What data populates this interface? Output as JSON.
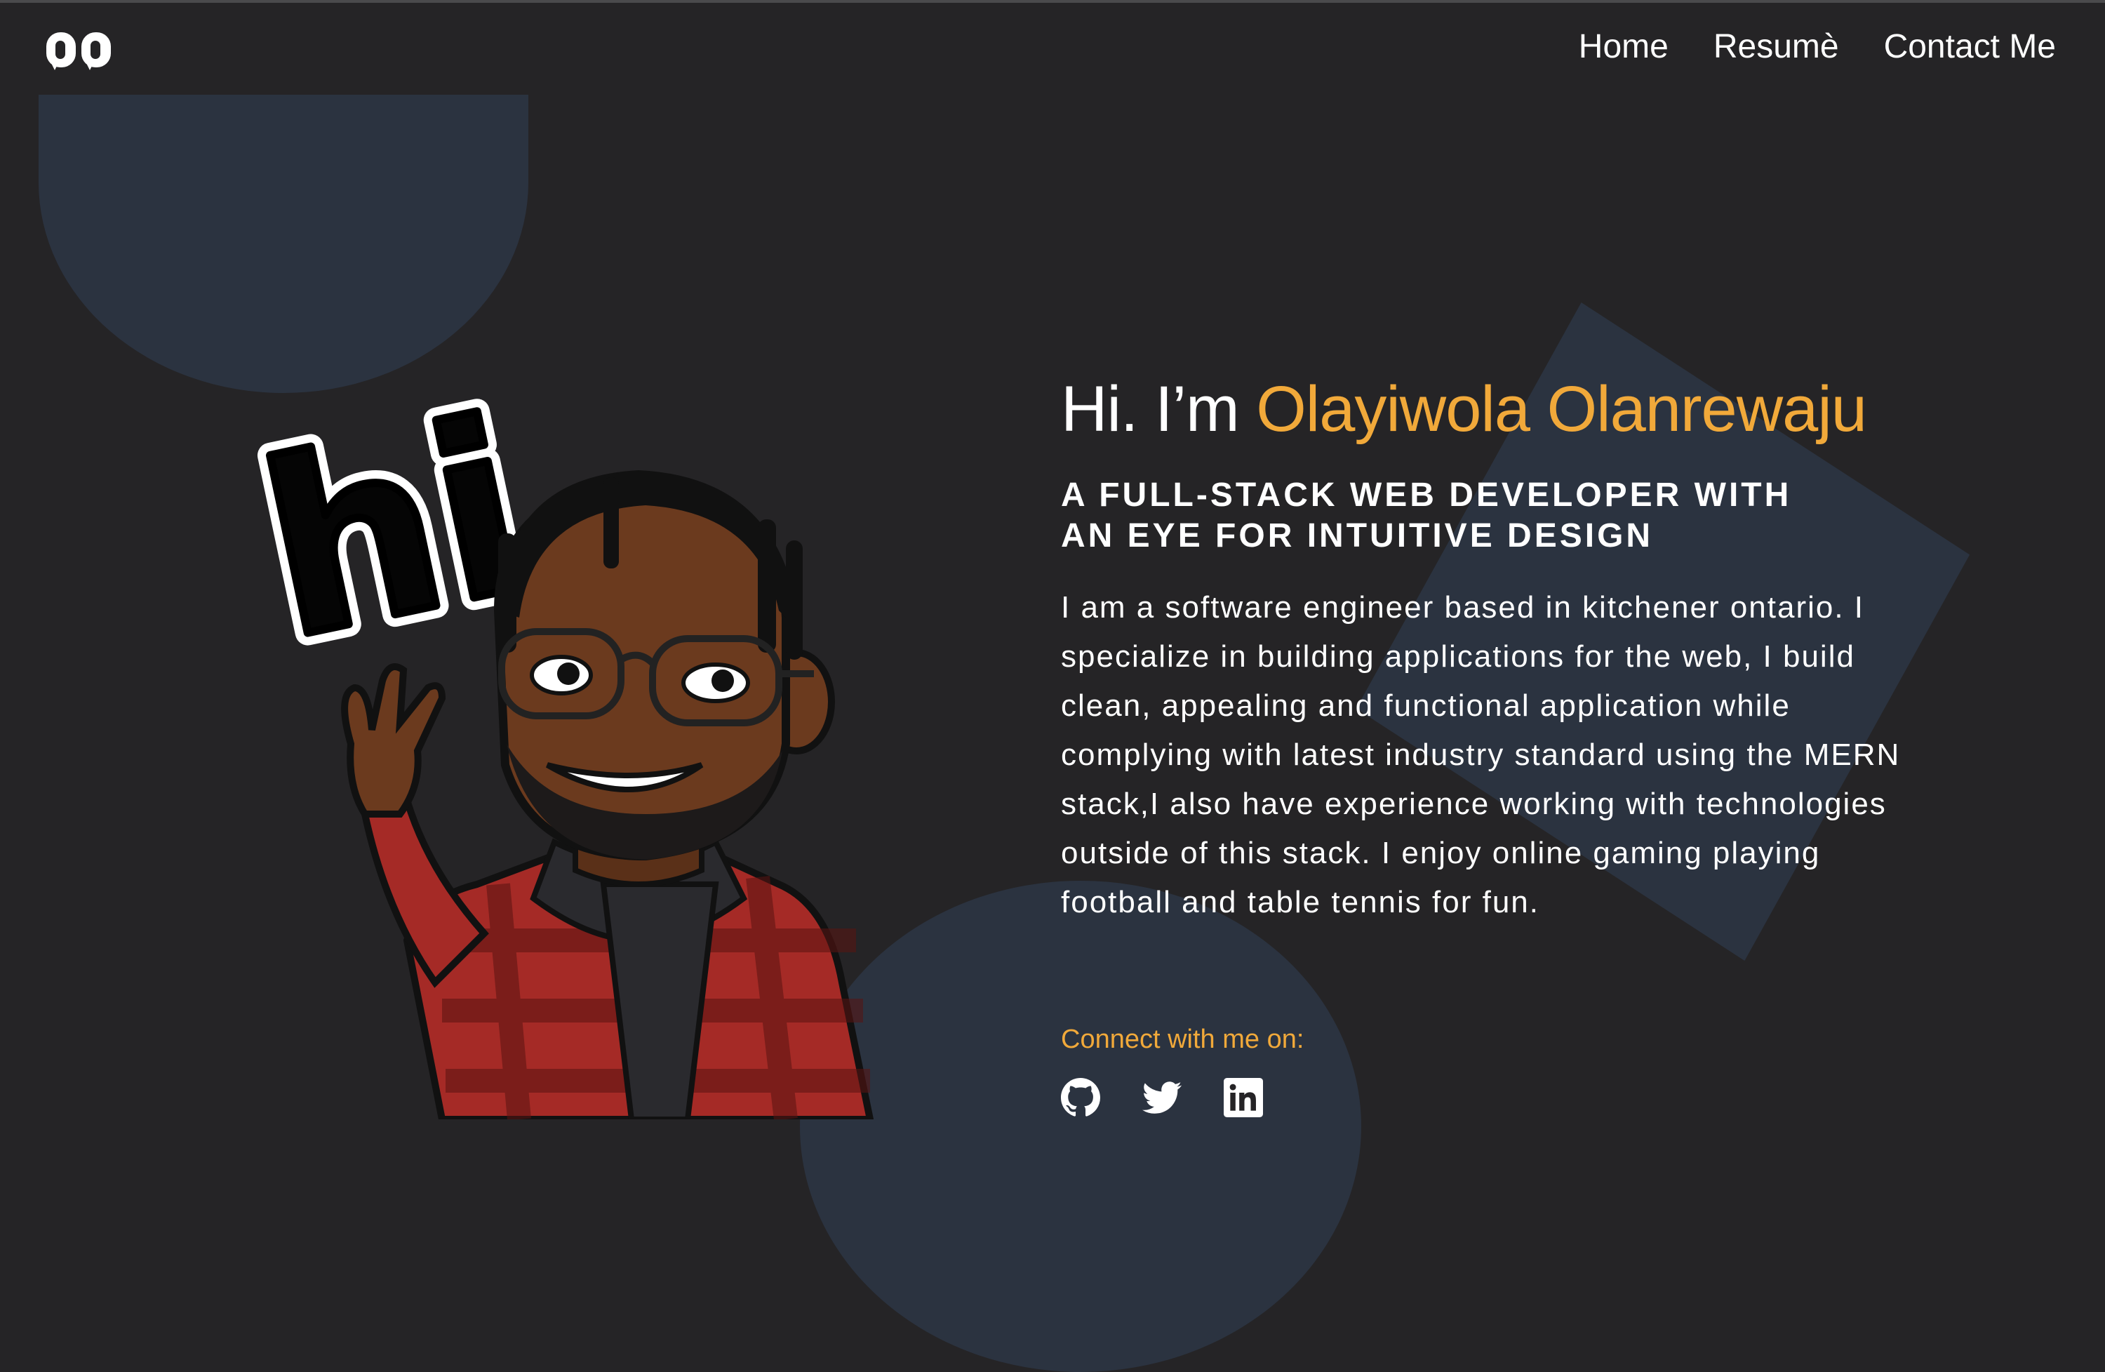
{
  "header": {
    "logo_icon": "oo-logo-icon",
    "nav": [
      {
        "label": "Home"
      },
      {
        "label": "Resumè"
      },
      {
        "label": "Contact Me"
      }
    ]
  },
  "hero": {
    "greeting_prefix": "Hi. I’m ",
    "name": "Olayiwola Olanrewaju",
    "tagline": "A FULL-STACK WEB DEVELOPER WITH AN EYE FOR INTUITIVE DESIGN",
    "bio": "I am a software engineer based in kitchener ontario. I specialize in building applications for the web, I build clean, appealing and functional application while complying with latest industry standard using the MERN stack,I also have experience working with technologies outside of this stack. I enjoy online gaming playing football and table tennis for fun.",
    "connect_label": "Connect with me on:",
    "hi_graphic": "hi",
    "socials": [
      {
        "icon": "github-icon"
      },
      {
        "icon": "twitter-icon"
      },
      {
        "icon": "linkedin-icon"
      }
    ]
  },
  "colors": {
    "background": "#252426",
    "accent": "#f1a93a",
    "shape": "#2b3340"
  }
}
